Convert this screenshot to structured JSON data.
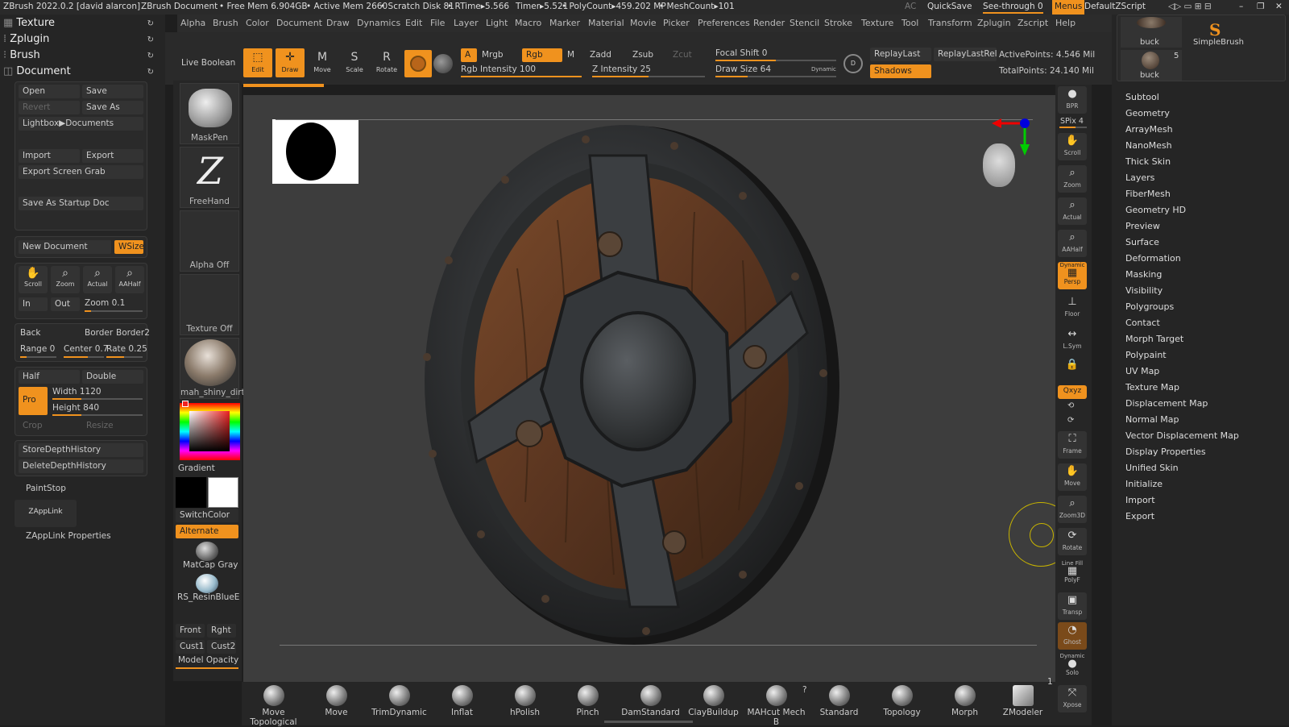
{
  "title": {
    "app": "ZBrush 2022.0.2 [david alarcon]",
    "doc": "ZBrush Document",
    "free_mem": "• Free Mem 6.904GB",
    "active_mem": "• Active Mem 2660",
    "scratch": "• Scratch Disk 81",
    "rtime": "• RTime▸5.566",
    "timer": "Timer▸5.521",
    "polycount": "• PolyCount▸459.202 MP",
    "meshcount": "• MeshCount▸101",
    "ac": "AC",
    "quicksave": "QuickSave",
    "seethrough": "See-through",
    "seethrough_val": "0",
    "menus": "Menus",
    "zscript": "DefaultZScript"
  },
  "menu": [
    "Alpha",
    "Brush",
    "Color",
    "Document",
    "Draw",
    "Dynamics",
    "Edit",
    "File",
    "Layer",
    "Light",
    "Macro",
    "Marker",
    "Material",
    "Movie",
    "Picker",
    "Preferences",
    "Render",
    "Stencil",
    "Stroke",
    "Texture",
    "Tool",
    "Transform",
    "Zplugin",
    "Zscript",
    "Help"
  ],
  "left": {
    "tree": [
      "Texture",
      "Zplugin",
      "Brush",
      "Document"
    ],
    "open": "Open",
    "save": "Save",
    "revert": "Revert",
    "saveas": "Save As",
    "lightbox": "Lightbox▶Documents",
    "import": "Import",
    "export": "Export",
    "export_screen": "Export Screen Grab",
    "startup": "Save As Startup Doc",
    "new_doc": "New Document",
    "wsize": "WSize",
    "scroll": "Scroll",
    "zoom": "Zoom",
    "actual": "Actual",
    "aahalf": "AAHalf",
    "in": "In",
    "out": "Out",
    "zoom_lbl": "Zoom",
    "zoom_val": "0.1",
    "back": "Back",
    "border": "Border",
    "border2": "Border2",
    "range_lbl": "Range",
    "range_val": "0",
    "center_lbl": "Center",
    "center_val": "0.7",
    "rate_lbl": "Rate",
    "rate_val": "0.25",
    "half": "Half",
    "double": "Double",
    "pro": "Pro",
    "width_lbl": "Width",
    "width_val": "1120",
    "height_lbl": "Height",
    "height_val": "840",
    "crop": "Crop",
    "resize": "Resize",
    "store_depth": "StoreDepthHistory",
    "delete_depth": "DeleteDepthHistory",
    "paintstop": "PaintStop",
    "zapplink": "ZAppLink",
    "zapplink_props": "ZAppLink Properties"
  },
  "toolbar": {
    "live_boolean": "Live Boolean",
    "edit": "Edit",
    "draw": "Draw",
    "move": "Move",
    "scale": "Scale",
    "rotate": "Rotate",
    "a": "A",
    "mrgb": "Mrgb",
    "rgb": "Rgb",
    "m": "M",
    "zadd": "Zadd",
    "zsub": "Zsub",
    "zcut": "Zcut",
    "rgb_int_lbl": "Rgb Intensity",
    "rgb_int_val": "100",
    "z_int_lbl": "Z Intensity",
    "z_int_val": "25",
    "focal_lbl": "Focal Shift",
    "focal_val": "0",
    "drawsize_lbl": "Draw Size",
    "drawsize_val": "64",
    "dynamic": "Dynamic",
    "replaylast": "ReplayLast",
    "replaylastrel": "ReplayLastRel",
    "shadows": "Shadows",
    "active_points": "ActivePoints: 4.546 Mil",
    "total_points": "TotalPoints: 24.140 Mil"
  },
  "shelf": {
    "maskpen": "MaskPen",
    "freehand": "FreeHand",
    "alpha_off": "Alpha Off",
    "texture_off": "Texture Off",
    "material": "mah_shiny_dirty",
    "gradient": "Gradient",
    "switchcolor": "SwitchColor",
    "alternate": "Alternate",
    "matcap": "MatCap Gray",
    "resin": "RS_ResinBlueEdge",
    "front": "Front",
    "right": "Rght",
    "cust1": "Cust1",
    "cust2": "Cust2",
    "model_opacity": "Model Opacity"
  },
  "rightshelf": {
    "bpr": "BPR",
    "spix": "SPix 4",
    "scroll": "Scroll",
    "zoom": "Zoom",
    "actual": "Actual",
    "aahalf": "AAHalf",
    "persp": "Persp",
    "dynamic": "Dynamic",
    "floor": "Floor",
    "lsym": "L.Sym",
    "xyz": "Qxyz",
    "frame": "Frame",
    "move": "Move",
    "zoom3d": "Zoom3D",
    "rotate": "Rotate",
    "linefill": "Line Fill",
    "polyf": "PolyF",
    "transp": "Transp",
    "ghost": "Ghost",
    "solo": "Solo",
    "xpose": "Xpose"
  },
  "right": {
    "buck1": "buck",
    "buck2": "buck",
    "simplebrush": "SimpleBrush",
    "count": "5",
    "items": [
      "Subtool",
      "Geometry",
      "ArrayMesh",
      "NanoMesh",
      "Thick Skin",
      "Layers",
      "FiberMesh",
      "Geometry HD",
      "Preview",
      "Surface",
      "Deformation",
      "Masking",
      "Visibility",
      "Polygroups",
      "Contact",
      "Morph Target",
      "Polypaint",
      "UV Map",
      "Texture Map",
      "Displacement Map",
      "Normal Map",
      "Vector Displacement Map",
      "Display Properties",
      "Unified Skin",
      "Initialize",
      "Import",
      "Export"
    ]
  },
  "brushes": [
    "Move Topological",
    "Move",
    "TrimDynamic",
    "Inflat",
    "hPolish",
    "Pinch",
    "DamStandard",
    "ClayBuildup",
    "MAHcut Mech B",
    "Standard",
    "Topology",
    "Morph",
    "ZModeler"
  ],
  "brush_badges": {
    "mahcut": "?",
    "zmodeler": "1"
  }
}
